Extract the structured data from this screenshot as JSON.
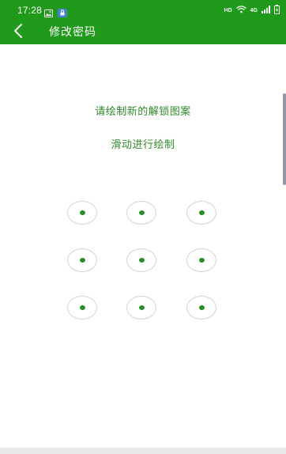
{
  "status_bar": {
    "time": "17:28",
    "left_icons": [
      "image-icon",
      "lock-notification-icon"
    ],
    "hd_label": "HD",
    "network_label": "4G",
    "right_icons": [
      "wifi-icon",
      "signal-icon",
      "battery-icon"
    ]
  },
  "app_bar": {
    "title": "修改密码",
    "back_icon": "chevron-left-icon"
  },
  "prompt": {
    "title": "请绘制新的解锁图案",
    "hint": "滑动进行绘制"
  },
  "pattern": {
    "rows": 3,
    "cols": 3,
    "nodes": [
      1,
      2,
      3,
      4,
      5,
      6,
      7,
      8,
      9
    ]
  },
  "colors": {
    "primary": "#1f9a1a",
    "accent_text": "#2e8b2a",
    "dot": "#2a8c24",
    "node_border": "#d4d4d4"
  }
}
